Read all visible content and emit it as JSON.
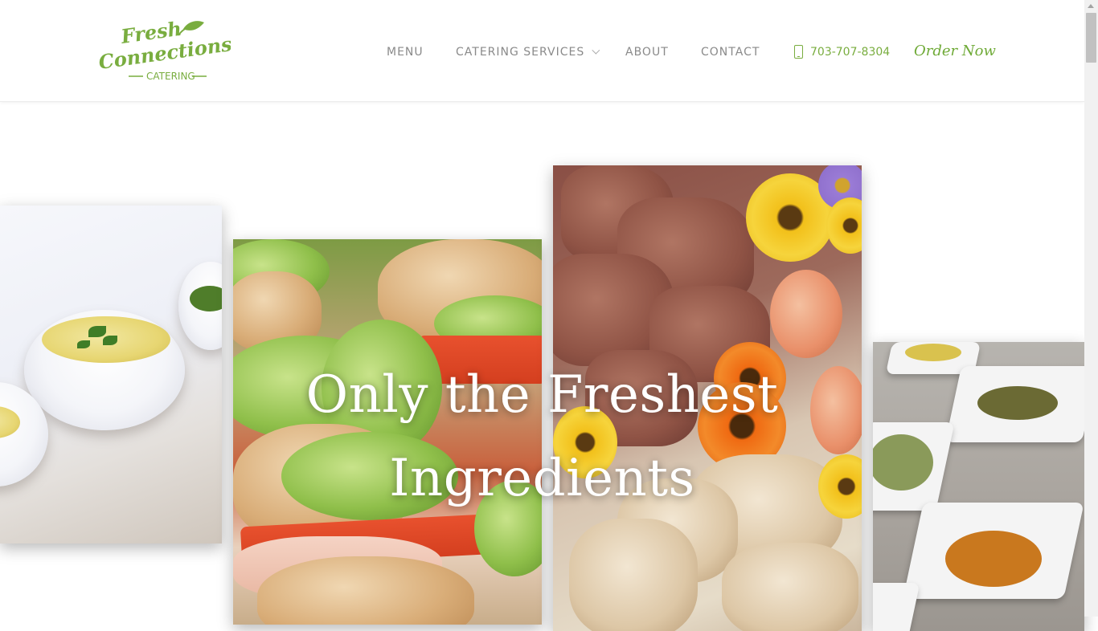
{
  "brand": {
    "logo_line1": "Fresh",
    "logo_line2": "Connections",
    "logo_line3": "CATERING",
    "accent_color": "#79ad3f"
  },
  "nav": {
    "menu": "MENU",
    "catering_services": "CATERING SERVICES",
    "about": "ABOUT",
    "contact": "CONTACT",
    "phone": "703-707-8304",
    "order_now": "Order Now"
  },
  "hero": {
    "title_line1": "Only the Freshest",
    "title_line2": "Ingredients"
  },
  "icons": {
    "phone": "mobile-phone-icon",
    "dropdown": "chevron-down-icon",
    "logo_leaf": "leaf-icon"
  }
}
